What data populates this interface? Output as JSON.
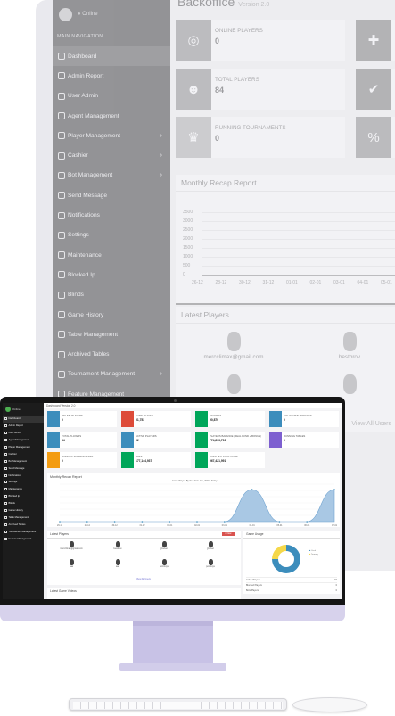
{
  "back_screen": {
    "user_status": "Online",
    "nav_header": "MAIN NAVIGATION",
    "title": "Backoffice",
    "version": "Version 2.0",
    "nav_items": [
      {
        "label": "Dashboard",
        "icon": "dashboard-icon",
        "chevron": false
      },
      {
        "label": "Admin Report",
        "icon": "report-icon",
        "chevron": false
      },
      {
        "label": "User Admin",
        "icon": "user-admin-icon",
        "chevron": false
      },
      {
        "label": "Agent Management",
        "icon": "agent-icon",
        "chevron": false
      },
      {
        "label": "Player Management",
        "icon": "player-icon",
        "chevron": true
      },
      {
        "label": "Cashier",
        "icon": "cashier-icon",
        "chevron": true
      },
      {
        "label": "Bot Management",
        "icon": "bot-icon",
        "chevron": true
      },
      {
        "label": "Send Message",
        "icon": "message-icon",
        "chevron": false
      },
      {
        "label": "Notifications",
        "icon": "bell-icon",
        "chevron": false
      },
      {
        "label": "Settings",
        "icon": "gear-icon",
        "chevron": false
      },
      {
        "label": "Maintenance",
        "icon": "wrench-icon",
        "chevron": false
      },
      {
        "label": "Blocked Ip",
        "icon": "block-icon",
        "chevron": false
      },
      {
        "label": "Blinds",
        "icon": "blinds-icon",
        "chevron": false
      },
      {
        "label": "Game History",
        "icon": "history-icon",
        "chevron": false
      },
      {
        "label": "Table Management",
        "icon": "table-icon",
        "chevron": false
      },
      {
        "label": "Archived Tables",
        "icon": "archive-icon",
        "chevron": false
      },
      {
        "label": "Tournament Management",
        "icon": "trophy-icon",
        "chevron": true
      },
      {
        "label": "Feature Management",
        "icon": "feature-icon",
        "chevron": false
      }
    ],
    "cards": [
      {
        "label": "ONLINE PLAYERS",
        "value": "0",
        "color": "#3c8dbc",
        "icon": "globe-icon"
      },
      {
        "label": "GAME PLAYED",
        "value": "51,753",
        "color": "#dd4b39",
        "icon": "gamepad-icon"
      },
      {
        "label": "TOTAL PLAYERS",
        "value": "84",
        "color": "#3c8dbc",
        "icon": "users-icon"
      },
      {
        "label": "ACTIVE PLAYERS",
        "value": "62",
        "color": "#dd4b39",
        "icon": "user-check-icon"
      },
      {
        "label": "RUNNING TOURNAMENTS",
        "value": "0",
        "color": "#f39c12",
        "icon": "trophy-icon"
      },
      {
        "label": "BOTS",
        "value": "177,144,937",
        "color": "#00a65a",
        "icon": "percent-icon"
      }
    ],
    "recap_title": "Monthly Recap Report",
    "y_ticks": [
      "3500",
      "3000",
      "2500",
      "2000",
      "1500",
      "1000",
      "500",
      "0"
    ],
    "x_ticks": [
      "26-12",
      "28-12",
      "30-12",
      "31-12",
      "01-01",
      "02-01",
      "03-01",
      "04-01",
      "05-01",
      "06-01",
      "07-01"
    ],
    "latest_players_title": "Latest Players",
    "players": [
      "mercclimax@gmail.com",
      "bestbrov",
      "",
      ""
    ],
    "view_all": "View All Users"
  },
  "front_screen": {
    "user_status": "Online",
    "top_title": "Dashboard  Version 2.0",
    "nav_items": [
      "Dashboard",
      "Admin Report",
      "User Admin",
      "Agent Management",
      "Player Management",
      "Cashier",
      "Bot Management",
      "Send Message",
      "Notifications",
      "Settings",
      "Maintenance",
      "Blocked Ip",
      "Blinds",
      "Game History",
      "Table Management",
      "Archived Tables",
      "Tournament Management",
      "Feature Management"
    ],
    "cards": [
      {
        "label": "ONLINE PLAYERS",
        "value": "0",
        "color": "#3c8dbc"
      },
      {
        "label": "GAME PLAYED",
        "value": "51,753",
        "color": "#dd4b39"
      },
      {
        "label": "JACKPOT",
        "value": "90,870",
        "color": "#00a65a"
      },
      {
        "label": "COLLECTIVE BONUSES",
        "value": "0",
        "color": "#3c8dbc"
      },
      {
        "label": "TOTAL PLAYERS",
        "value": "84",
        "color": "#3c8dbc"
      },
      {
        "label": "ACTIVE PLAYERS",
        "value": "62",
        "color": "#3c8dbc"
      },
      {
        "label": "PLAYERS BALANCE (REAL FUND + BONUS)",
        "value": "774,893,703",
        "color": "#00a65a"
      },
      {
        "label": "RUNNING TABLES",
        "value": "0",
        "color": "#7d5fd0"
      },
      {
        "label": "RUNNING TOURNAMENTS",
        "value": "0",
        "color": "#f39c12"
      },
      {
        "label": "BOTS",
        "value": "177,144,937",
        "color": "#00a65a"
      },
      {
        "label": "TOTAL BALANCE CHIPS",
        "value": "967,421,991",
        "color": "#00a65a"
      }
    ],
    "recap_title": "Monthly Recap Report",
    "recap_chart_title": "Game Played By their from Jan, 2020 - Today",
    "latest_players_title": "Latest Players",
    "new_badge": "8 New Members",
    "players_row1": [
      "mercclimax@gmail.com",
      "bestbrov",
      "jjrocket",
      "jjrocket"
    ],
    "players_row2": [
      "aaa",
      "aaa",
      "pomboys",
      "pomboys"
    ],
    "view_all": "View All Users",
    "game_usage_title": "Game Usage",
    "usage_legend": [
      "Cash",
      "Tourney"
    ],
    "usage_rows": [
      {
        "label": "Active Players",
        "value": "62"
      },
      {
        "label": "Blocked Players",
        "value": "0"
      },
      {
        "label": "Bots Players",
        "value": "0"
      }
    ],
    "latest_games_title": "Latest Game Videos"
  },
  "chart_data": {
    "type": "area",
    "title": "Game Played By their from Jan, 2020 - Today",
    "x": [
      "26-12",
      "28-12",
      "30-12",
      "31-12",
      "01-01",
      "02-01",
      "03-01",
      "04-01",
      "05-01",
      "06-01",
      "07-01"
    ],
    "series": [
      {
        "values": [
          0,
          0,
          0,
          0,
          0,
          0,
          0,
          3000,
          0,
          0,
          3000
        ]
      }
    ],
    "ylim": [
      0,
      3500
    ]
  },
  "pie_data": {
    "type": "pie",
    "labels": [
      "Cash",
      "Tourney"
    ],
    "values": [
      75,
      25
    ],
    "colors": [
      "#3c8dbc",
      "#f5d84a"
    ]
  }
}
